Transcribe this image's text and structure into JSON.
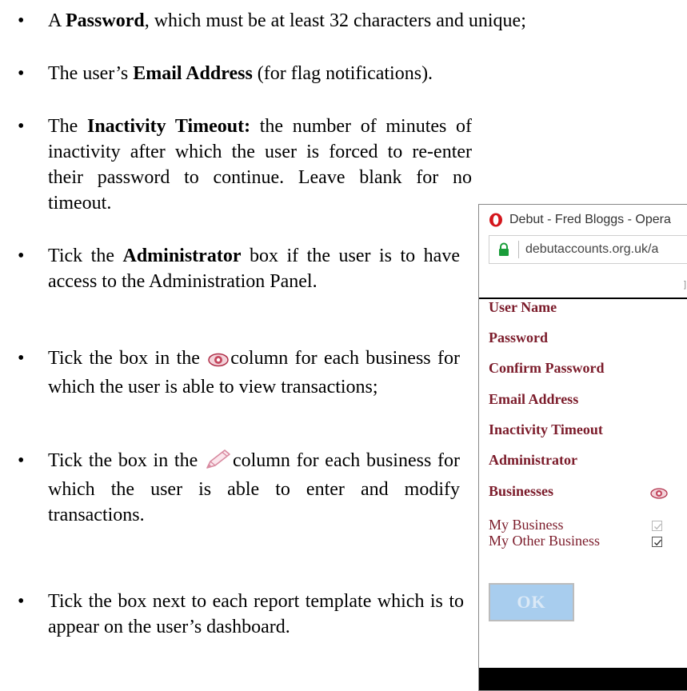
{
  "bullets": {
    "symbol": "•",
    "password": {
      "pre": "A ",
      "bold": "Password",
      "post": ", which must be at least 32 characters and unique;"
    },
    "email": {
      "pre": "The user’s ",
      "bold": "Email Address",
      "post": " (for flag notifications)."
    },
    "timeout": {
      "pre": "The ",
      "bold": "Inactivity Timeout:",
      "post": " the number of minutes of inactivity after which the user is forced to re-enter their password to continue. Leave blank for no timeout."
    },
    "admin": {
      "pre": "Tick the ",
      "bold": "Administrator",
      "post": " box if the user is to have access to the Administration Panel."
    },
    "view": {
      "pre": "Tick the box in the ",
      "icon": "eye-icon",
      "post": "column for each business for which the user is able to view transactions;"
    },
    "edit": {
      "pre": "Tick the box in the ",
      "icon": "pencil-icon",
      "post": "column for each business for which the user is able to enter and modify transactions."
    },
    "report": {
      "text": "Tick the box next to each report template which is to appear on the user’s dashboard."
    }
  },
  "browser": {
    "title": "Debut - Fred Bloggs - Opera",
    "address": "debutaccounts.org.uk/a",
    "header_fragment": "]",
    "logo_icon": "opera-logo-icon",
    "lock_icon": "lock-icon"
  },
  "form": {
    "labels": {
      "user_name": "User Name",
      "password": "Password",
      "confirm_password": "Confirm Password",
      "email": "Email Address",
      "inactivity_timeout": "Inactivity Timeout",
      "administrator": "Administrator",
      "businesses": "Businesses"
    },
    "businesses": [
      {
        "name": "My Business",
        "view_checked": true,
        "view_disabled": true
      },
      {
        "name": "My Other Business",
        "view_checked": true,
        "view_disabled": false
      }
    ],
    "ok_label": "OK"
  },
  "colors": {
    "label": "#7b1b2a",
    "ok_button": "#a8cdee",
    "eye_icon": "#b0304a",
    "pencil_icon": "#d88aa0"
  }
}
